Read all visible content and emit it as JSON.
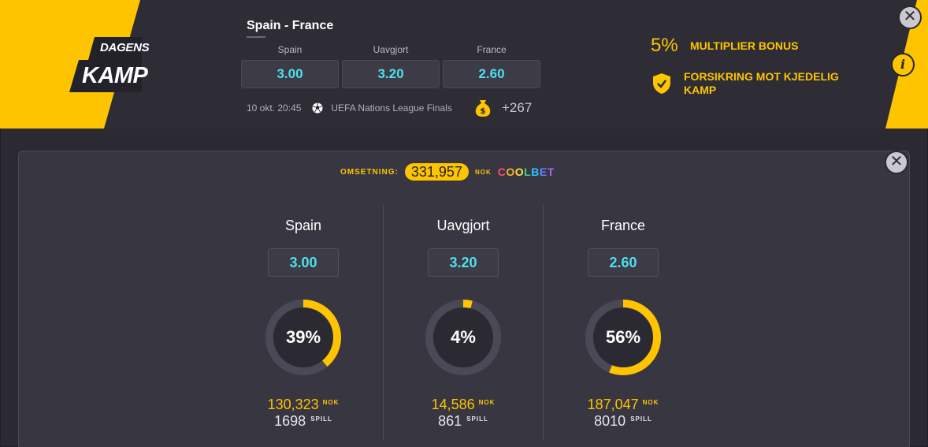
{
  "banner": {
    "dagens": "DAGENS",
    "kamp": "KAMP",
    "match_title": "Spain - France",
    "odds": [
      {
        "label": "Spain",
        "value": "3.00"
      },
      {
        "label": "Uavgjort",
        "value": "3.20"
      },
      {
        "label": "France",
        "value": "2.60"
      }
    ],
    "datetime": "10 okt. 20:45",
    "competition": "UEFA Nations League Finals",
    "more_markets": "+267",
    "bonus_percent": "5%",
    "bonus_label": "MULTIPLIER BONUS",
    "insurance_label": "FORSIKRING MOT KJEDELIG KAMP",
    "info_symbol": "i",
    "close_symbol": "✕"
  },
  "panel": {
    "turnover_label": "OMSETNING:",
    "turnover_value": "331,957",
    "currency": "NOK",
    "brand": "COOLBET",
    "close_symbol": "✕",
    "outcomes": [
      {
        "name": "Spain",
        "odds": "3.00",
        "percent": 39,
        "percent_label": "39%",
        "stake": "130,323",
        "stake_unit": "NOK",
        "bets": "1698",
        "bets_unit": "SPILL"
      },
      {
        "name": "Uavgjort",
        "odds": "3.20",
        "percent": 4,
        "percent_label": "4%",
        "stake": "14,586",
        "stake_unit": "NOK",
        "bets": "861",
        "bets_unit": "SPILL"
      },
      {
        "name": "France",
        "odds": "2.60",
        "percent": 56,
        "percent_label": "56%",
        "stake": "187,047",
        "stake_unit": "NOK",
        "bets": "8010",
        "bets_unit": "SPILL"
      }
    ]
  },
  "colors": {
    "accent": "#ffc400",
    "odds_text": "#4ee0f0",
    "background": "#2b2a33",
    "panel": "#373641",
    "ring_track": "#4a4955",
    "ring_inner": "#2b2a33"
  },
  "icons": [
    "close-icon",
    "info-icon",
    "football-icon",
    "money-bag-icon",
    "shield-check-icon"
  ]
}
